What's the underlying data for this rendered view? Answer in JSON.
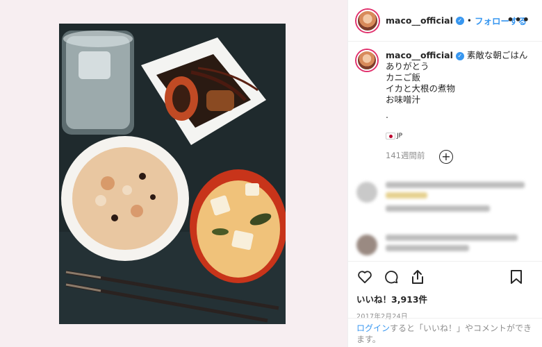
{
  "post": {
    "username": "maco__official",
    "follow_label": "フォローする",
    "separator": "•",
    "more_label": "•••",
    "caption": {
      "first_line": "素敵な朝ごはんありがとう",
      "lines": [
        "カニご飯",
        "イカと大根の煮物",
        "お味噌汁"
      ],
      "dot": ".",
      "flag_label": "JP"
    },
    "time_ago": "141週間前",
    "likes_label": "いいね！3,913件",
    "date": "2017年2月24日",
    "login": {
      "link_label": "ログイン",
      "rest_text": "すると「いいね！」やコメントができます。"
    }
  },
  "icons": {
    "verified": "verified-badge-icon",
    "load_more": "plus-circle-icon",
    "like": "heart-icon",
    "comment": "comment-icon",
    "share": "share-icon",
    "save": "bookmark-icon"
  },
  "colors": {
    "accent": "#3897f0",
    "text": "#262626",
    "muted": "#8e8e8e",
    "left_bg": "#f7eef1"
  }
}
